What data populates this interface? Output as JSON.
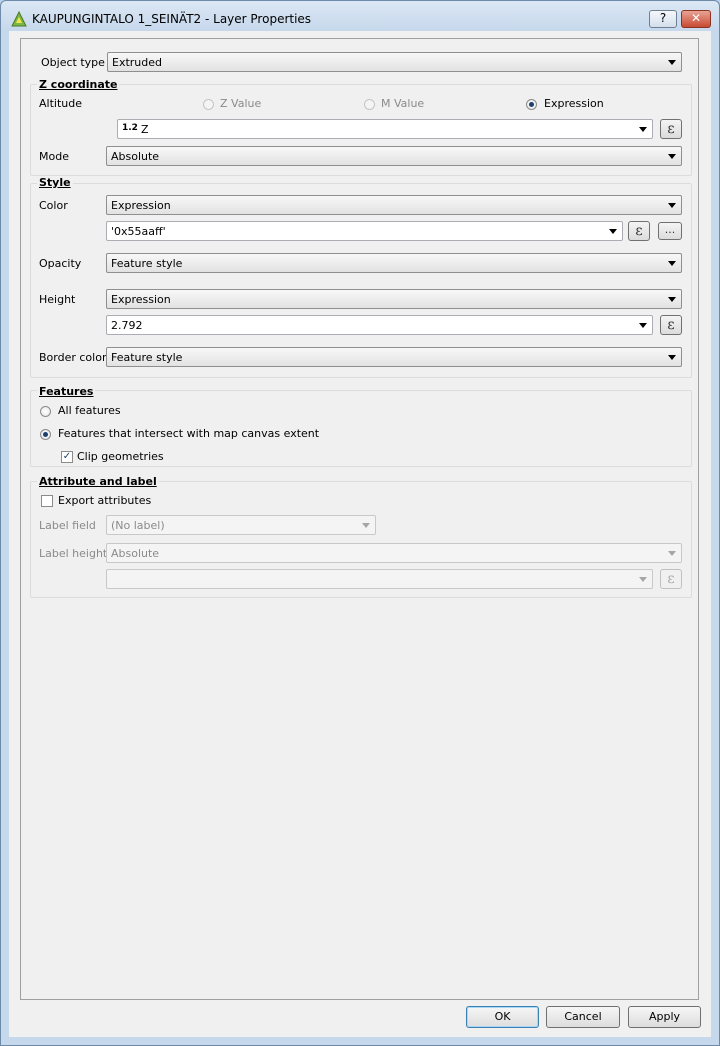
{
  "window": {
    "title": "KAUPUNGINTALO 1_SEINÄT2 - Layer Properties",
    "help_label": "?",
    "close_label": "✕"
  },
  "object_type": {
    "label": "Object type",
    "value": "Extruded"
  },
  "z_coordinate": {
    "title": "Z coordinate",
    "altitude_label": "Altitude",
    "options": [
      "Z Value",
      "M Value",
      "Expression"
    ],
    "selected": "Expression",
    "expr_badge": "1.2",
    "expression": "Z",
    "mode_label": "Mode",
    "mode_value": "Absolute"
  },
  "style": {
    "title": "Style",
    "color_label": "Color",
    "color_value": "Expression",
    "color_expression": "'0x55aaff'",
    "opacity_label": "Opacity",
    "opacity_value": "Feature style",
    "height_label": "Height",
    "height_value": "Expression",
    "height_expression": "2.792",
    "border_label": "Border color",
    "border_value": "Feature style",
    "more_label": "..."
  },
  "features": {
    "title": "Features",
    "all_label": "All features",
    "intersect_label": "Features that intersect with map canvas extent",
    "clip_label": "Clip geometries",
    "clip_checked": true
  },
  "attribute": {
    "title": "Attribute and label",
    "export_label": "Export attributes",
    "label_field_label": "Label field",
    "label_field_value": "(No label)",
    "label_height_label": "Label height",
    "label_height_value": "Absolute",
    "label_expression": ""
  },
  "expr_symbol": "ε",
  "buttons": {
    "ok": "OK",
    "cancel": "Cancel",
    "apply": "Apply"
  },
  "colors": {
    "accent": "#1f3f6f",
    "title_bar": "#c6d8ec"
  }
}
